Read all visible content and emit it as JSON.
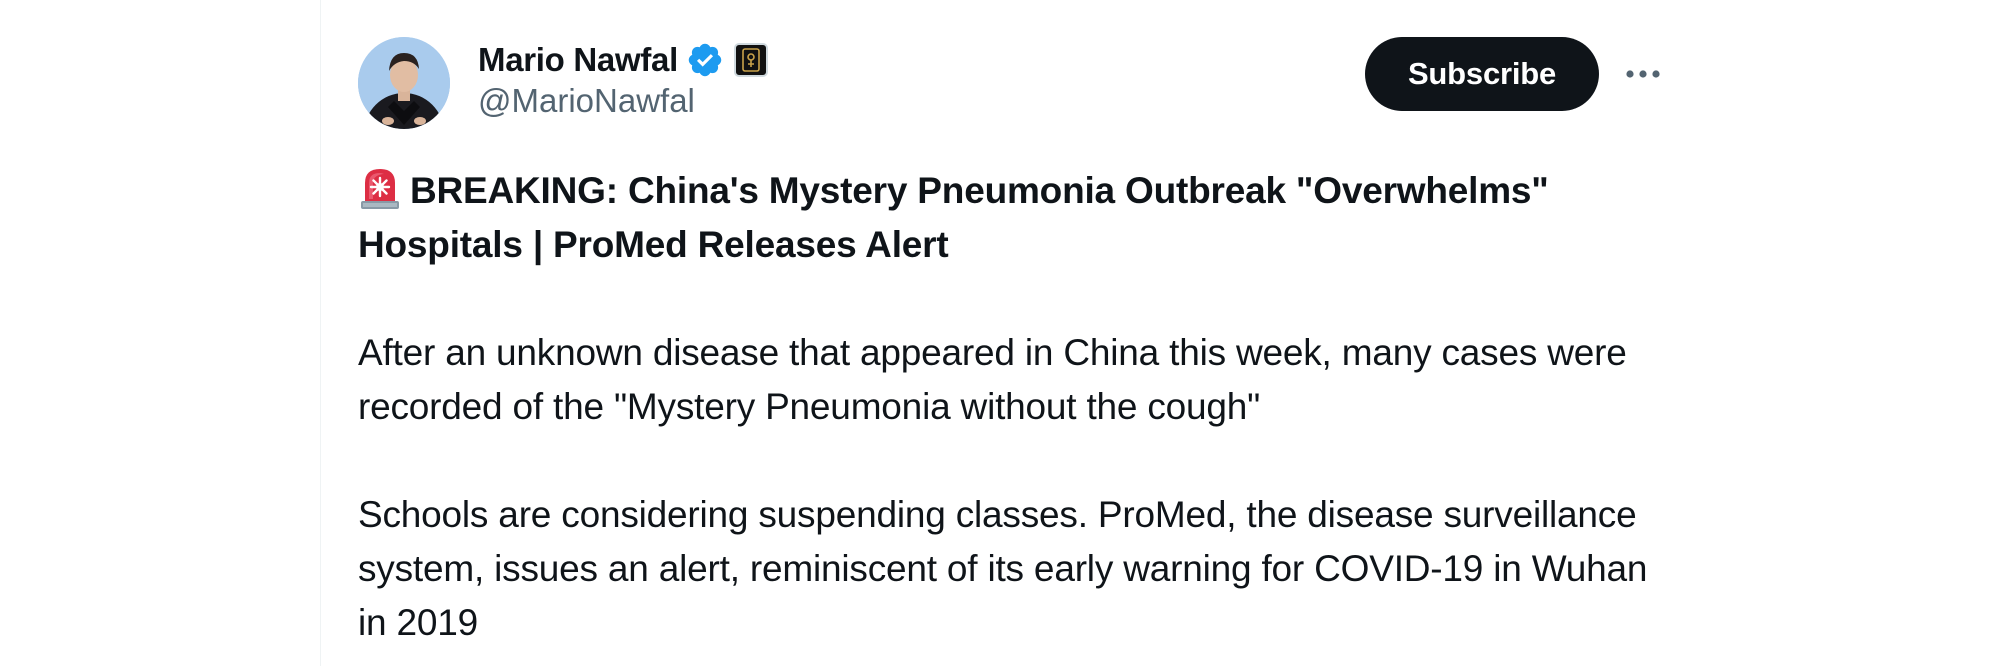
{
  "author": {
    "display_name": "Mario Nawfal",
    "handle": "@MarioNawfal",
    "verified": true,
    "verified_color": "#1d9bf0"
  },
  "actions": {
    "subscribe_label": "Subscribe",
    "more_icon": "more-horizontal-icon"
  },
  "tweet": {
    "headline_icon": "rotating-light-icon",
    "headline": "BREAKING: China's Mystery Pneumonia Outbreak \"Overwhelms\" Hospitals | ProMed Releases Alert",
    "paragraphs": [
      "After an unknown disease that appeared in China this week, many cases were recorded of the \"Mystery Pneumonia without the cough\"",
      "Schools are considering suspending classes. ProMed, the disease surveillance system, issues an alert, reminiscent of its early warning for COVID-19 in Wuhan in 2019"
    ]
  },
  "colors": {
    "text_primary": "#0f1419",
    "text_secondary": "#536471",
    "button_bg": "#0f1419",
    "button_text": "#ffffff"
  }
}
